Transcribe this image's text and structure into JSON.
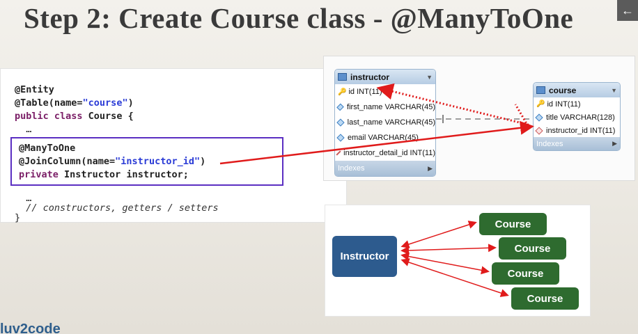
{
  "slide": {
    "title": "Step 2: Create Course class - @ManyToOne",
    "nav_back": "←",
    "footer_logo": "luv2code",
    "footer_text": "luv2code"
  },
  "code": {
    "lines": [
      "@Entity",
      "@Table(name=",
      "\"course\"",
      ")",
      "public class",
      " Course {",
      "  …",
      "@ManyToOne",
      "@JoinColumn(name=",
      "\"instructor_id\"",
      ")",
      "private",
      " Instructor instructor;",
      "  …",
      "  // constructors, getters / setters",
      "}"
    ]
  },
  "erd": {
    "instructor_table": {
      "name": "instructor",
      "columns": [
        "id INT(11)",
        "first_name VARCHAR(45)",
        "last_name VARCHAR(45)",
        "email VARCHAR(45)",
        "instructor_detail_id INT(11)"
      ],
      "footer": "Indexes"
    },
    "course_table": {
      "name": "course",
      "columns": [
        "id INT(11)",
        "title VARCHAR(128)",
        "instructor_id INT(11)"
      ],
      "footer": "Indexes"
    }
  },
  "relationship": {
    "instructor_label": "Instructor",
    "course_labels": [
      "Course",
      "Course",
      "Course",
      "Course"
    ]
  },
  "colors": {
    "arrow_red": "#e01b1b",
    "instructor_node": "#2d5b8e",
    "course_node": "#2e6b2f",
    "highlight_box": "#5b2fc2"
  }
}
